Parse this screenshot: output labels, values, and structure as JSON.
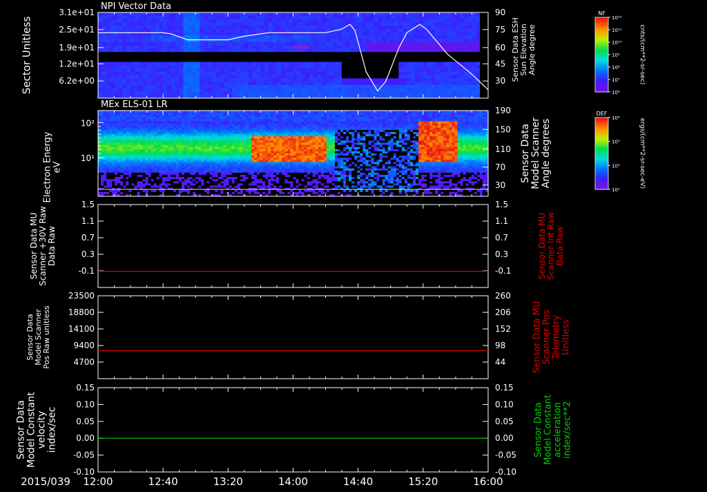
{
  "time_axis": {
    "date_label": "2015/039",
    "ticks": [
      "12:00",
      "12:40",
      "13:20",
      "14:00",
      "14:40",
      "15:20",
      "16:00"
    ]
  },
  "colors": {
    "background": "#000000",
    "foreground": "#ffffff",
    "red_trace": "#e00000",
    "green_trace": "#00d000"
  },
  "colorbars": [
    {
      "label": "NF",
      "tick_labels": [
        "10¹²",
        "10¹¹",
        "10¹⁰",
        "10⁹",
        "10⁸",
        "10⁷",
        "10⁶"
      ],
      "units": "cnts/(cm**2-sr-sec)"
    },
    {
      "label": "DEF",
      "tick_labels": [
        "10⁴",
        "10³",
        "10²",
        "10¹"
      ],
      "units": "ergs/(cm**2-sr-sec-eV)"
    }
  ],
  "chart_data": [
    {
      "type": "heatmap",
      "title": "NPI Vector Data",
      "ylabel": "Sector Unitless",
      "y_ticks": [
        "3.1e+01",
        "2.5e+01",
        "1.9e+01",
        "1.2e+01",
        "6.2e+00"
      ],
      "y2label": "Sensor Data ESH Sun Elevation Angle degree",
      "y2_ticks": [
        "90",
        "75",
        "60",
        "45",
        "30"
      ],
      "y2lim": [
        18,
        90
      ],
      "overlay_line": {
        "x": [
          "12:00",
          "12:40",
          "12:45",
          "12:55",
          "13:20",
          "13:30",
          "13:45",
          "14:20",
          "14:30",
          "14:35",
          "14:38",
          "14:45",
          "14:52",
          "14:57",
          "15:05",
          "15:10",
          "15:18",
          "15:22",
          "15:35",
          "15:50",
          "16:00"
        ],
        "y": [
          73,
          73,
          72,
          67,
          67,
          70,
          73,
          73,
          76,
          80,
          75,
          40,
          24,
          32,
          60,
          73,
          80,
          76,
          55,
          38,
          25
        ]
      },
      "colorscale": "NF"
    },
    {
      "type": "heatmap",
      "title": "MEx ELS-01 LR",
      "ylabel": "Electron Energy eV",
      "y_ticks": [
        "10²",
        "10¹"
      ],
      "y2label": "Sensor Data Model Scanner Angle degrees",
      "y2_ticks": [
        "190",
        "150",
        "110",
        "70",
        "30"
      ],
      "colorscale": "DEF"
    },
    {
      "type": "line",
      "ylabel": "Sensor Data MU Scanner +30V Raw Data Raw",
      "y_ticks": [
        "1.5",
        "1.1",
        "0.7",
        "0.3",
        "-0.1"
      ],
      "ylim": [
        -0.4,
        1.5
      ],
      "y2label": "Sensor Data MU Scanner Int Raw Data Raw",
      "y2_ticks": [
        "1.5",
        "1.1",
        "0.7",
        "0.3",
        "-0.1"
      ],
      "series": [
        {
          "color": "#e00000",
          "x": [
            "12:00",
            "16:00"
          ],
          "y": [
            -0.03,
            -0.03
          ]
        }
      ]
    },
    {
      "type": "line",
      "ylabel": "Sensor Data Model Scanner Pos Raw unitless",
      "y_ticks": [
        "23500",
        "18800",
        "14100",
        "9400",
        "4700"
      ],
      "ylim": [
        0,
        23500
      ],
      "y2label": "Sensor Data MU Scanner Pos Telemetry Unitless",
      "y2_ticks": [
        "260",
        "206",
        "152",
        "98",
        "44"
      ],
      "series": [
        {
          "color": "#e00000",
          "x": [
            "12:00",
            "16:00"
          ],
          "y": [
            7900,
            7900
          ]
        }
      ]
    },
    {
      "type": "line",
      "ylabel": "Sensor Data Model Constant velocity index/sec",
      "y_ticks": [
        "0.15",
        "0.10",
        "0.05",
        "0.00",
        "-0.05",
        "-0.10"
      ],
      "ylim": [
        -0.1,
        0.15
      ],
      "y2label": "Sensor Data Model Constant acceleration index/sec**2",
      "y2_ticks": [
        "0.15",
        "0.10",
        "0.05",
        "0.00",
        "-0.05",
        "-0.10"
      ],
      "series": [
        {
          "color": "#00d000",
          "x": [
            "12:00",
            "16:00"
          ],
          "y": [
            0.0,
            0.0
          ]
        }
      ]
    }
  ]
}
